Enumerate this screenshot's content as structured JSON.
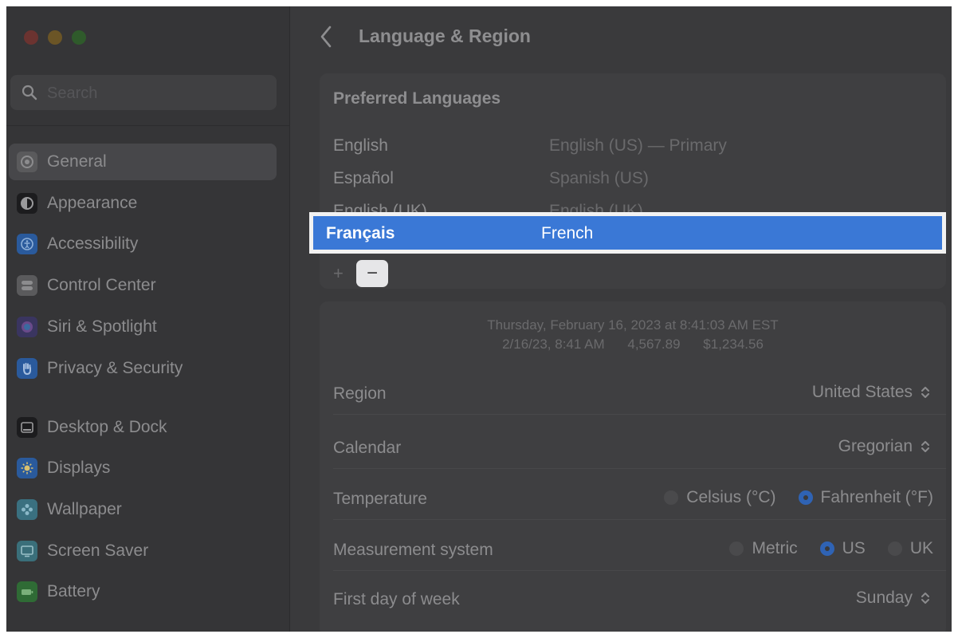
{
  "window": {
    "title": "Language & Region"
  },
  "sidebar": {
    "search_placeholder": "Search",
    "items": [
      {
        "label": "General",
        "icon": "gear-icon",
        "color": "#5a5a5c",
        "selected": true
      },
      {
        "label": "Appearance",
        "icon": "appearance-icon",
        "color": "#1c1c1e"
      },
      {
        "label": "Accessibility",
        "icon": "accessibility-icon",
        "color": "#2a5a9c"
      },
      {
        "label": "Control Center",
        "icon": "control-center-icon",
        "color": "#5a5a5c"
      },
      {
        "label": "Siri & Spotlight",
        "icon": "siri-icon",
        "color": "#3a3560"
      },
      {
        "label": "Privacy & Security",
        "icon": "hand-icon",
        "color": "#2a5a9c"
      },
      {
        "label": "Desktop & Dock",
        "icon": "dock-icon",
        "color": "#1c1c1e"
      },
      {
        "label": "Displays",
        "icon": "sun-icon",
        "color": "#2a5a9c"
      },
      {
        "label": "Wallpaper",
        "icon": "flower-icon",
        "color": "#3a7080"
      },
      {
        "label": "Screen Saver",
        "icon": "screen-saver-icon",
        "color": "#3a6f7a"
      },
      {
        "label": "Battery",
        "icon": "battery-icon",
        "color": "#2f6b35"
      }
    ]
  },
  "main": {
    "preferred_title": "Preferred Languages",
    "languages": [
      {
        "name": "English",
        "desc": "English (US) — Primary"
      },
      {
        "name": "Español",
        "desc": "Spanish (US)"
      },
      {
        "name": "English (UK)",
        "desc": "English (UK)"
      },
      {
        "name": "Français",
        "desc": "French",
        "selected": true
      }
    ],
    "add_label": "+",
    "remove_label": "−",
    "sample_line1": "Thursday, February 16, 2023 at 8:41:03 AM EST",
    "sample_date": "2/16/23, 8:41 AM",
    "sample_number": "4,567.89",
    "sample_currency": "$1,234.56",
    "region": {
      "label": "Region",
      "value": "United States"
    },
    "calendar": {
      "label": "Calendar",
      "value": "Gregorian"
    },
    "temperature": {
      "label": "Temperature",
      "options": [
        "Celsius (°C)",
        "Fahrenheit (°F)"
      ],
      "selected": "Fahrenheit (°F)"
    },
    "measurement": {
      "label": "Measurement system",
      "options": [
        "Metric",
        "US",
        "UK"
      ],
      "selected": "US"
    },
    "first_day": {
      "label": "First day of week",
      "value": "Sunday"
    }
  },
  "colors": {
    "accent": "#3a78d6",
    "highlight_border": "#f2f2f2"
  }
}
